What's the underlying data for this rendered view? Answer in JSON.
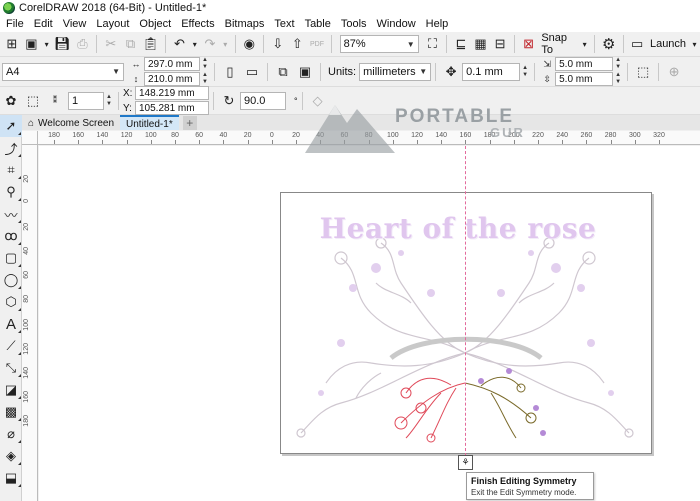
{
  "window": {
    "title": "CorelDRAW 2018 (64-Bit) - Untitled-1*"
  },
  "menu": [
    "File",
    "Edit",
    "View",
    "Layout",
    "Object",
    "Effects",
    "Bitmaps",
    "Text",
    "Table",
    "Tools",
    "Window",
    "Help"
  ],
  "toolbar1": {
    "zoom_value": "87%",
    "snap_to_label": "Snap To",
    "launch_label": "Launch",
    "pdf_label": "PDF"
  },
  "toolbar2": {
    "page_size": "A4",
    "page_width": "297.0 mm",
    "page_height": "210.0 mm",
    "units_label": "Units:",
    "units_value": "millimeters",
    "nudge_value": "0.1 mm",
    "dup_x": "5.0 mm",
    "dup_y": "5.0 mm"
  },
  "toolbar3": {
    "mirror_count": "1",
    "x_label": "X:",
    "x_value": "148.219 mm",
    "y_label": "Y:",
    "y_value": "105.281 mm",
    "rotation_value": "90.0",
    "degree_symbol": "°"
  },
  "tabs": {
    "welcome": "Welcome Screen",
    "document": "Untitled-1*",
    "add": "+"
  },
  "ruler": {
    "h_labels": [
      "180",
      "160",
      "140",
      "120",
      "100",
      "80",
      "60",
      "40",
      "20",
      "0",
      "20",
      "40",
      "60",
      "80",
      "100",
      "120",
      "140",
      "160",
      "180",
      "200",
      "220",
      "240",
      "260",
      "280",
      "300",
      "320"
    ],
    "v_labels": [
      "20",
      "0",
      "20",
      "40",
      "60",
      "80",
      "100",
      "120",
      "140",
      "160",
      "180"
    ],
    "unit": "millimeters"
  },
  "artwork": {
    "title": "Heart of the rose"
  },
  "tooltip": {
    "title": "Finish Editing Symmetry",
    "body": "Exit the Edit Symmetry mode."
  },
  "watermark": {
    "brand": "PORTABLE",
    "sub": "GUR"
  },
  "colors": {
    "accent": "#1e78c8",
    "symmetry_line": "#e36a9c",
    "title_lilac": "#e0c6ee",
    "branch_red": "#e04a5a",
    "branch_olive": "#7a6a2a",
    "flower_purple": "#b48ad6"
  }
}
